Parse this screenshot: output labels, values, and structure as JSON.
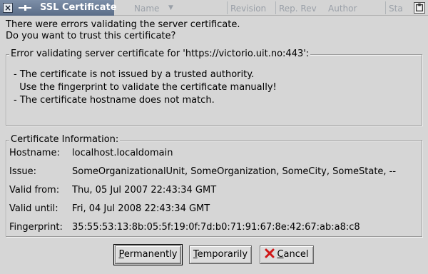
{
  "window": {
    "title": "SSL Certificate",
    "background_columns": [
      "Name",
      "Revision",
      "Rep. Rev",
      "Author",
      "Status"
    ]
  },
  "message": {
    "line1": "There were errors validating the server certificate.",
    "line2": "Do you want to trust this certificate?"
  },
  "errors": {
    "title": "Error validating server certificate for 'https://victorio.uit.no:443':",
    "lines": [
      "- The certificate is not issued by a trusted authority.",
      "  Use the fingerprint to validate the certificate manually!",
      "- The certificate hostname does not match."
    ]
  },
  "certificate": {
    "title": "Certificate Information:",
    "fields": [
      {
        "label": "Hostname:",
        "value": "localhost.localdomain"
      },
      {
        "label": "Issue:",
        "value": "SomeOrganizationalUnit, SomeOrganization, SomeCity, SomeState, --"
      },
      {
        "label": "Valid from:",
        "value": "Thu, 05 Jul 2007 22:43:34 GMT"
      },
      {
        "label": "Valid until:",
        "value": "Fri, 04 Jul 2008 22:43:34 GMT"
      },
      {
        "label": "Fingerprint:",
        "value": "35:55:53:13:8b:05:5f:19:0f:7d:b0:71:91:67:8e:42:67:ab:a8:c8"
      }
    ]
  },
  "buttons": {
    "permanently": {
      "mnemonic": "P",
      "rest": "ermanently"
    },
    "temporarily": {
      "mnemonic": "T",
      "rest": "emporarily"
    },
    "cancel": {
      "mnemonic": "C",
      "rest": "ancel"
    }
  },
  "colors": {
    "titlebar_active": "#6b7d98",
    "dialog_bg": "#d6d6d6",
    "cancel_icon": "#d01818"
  }
}
